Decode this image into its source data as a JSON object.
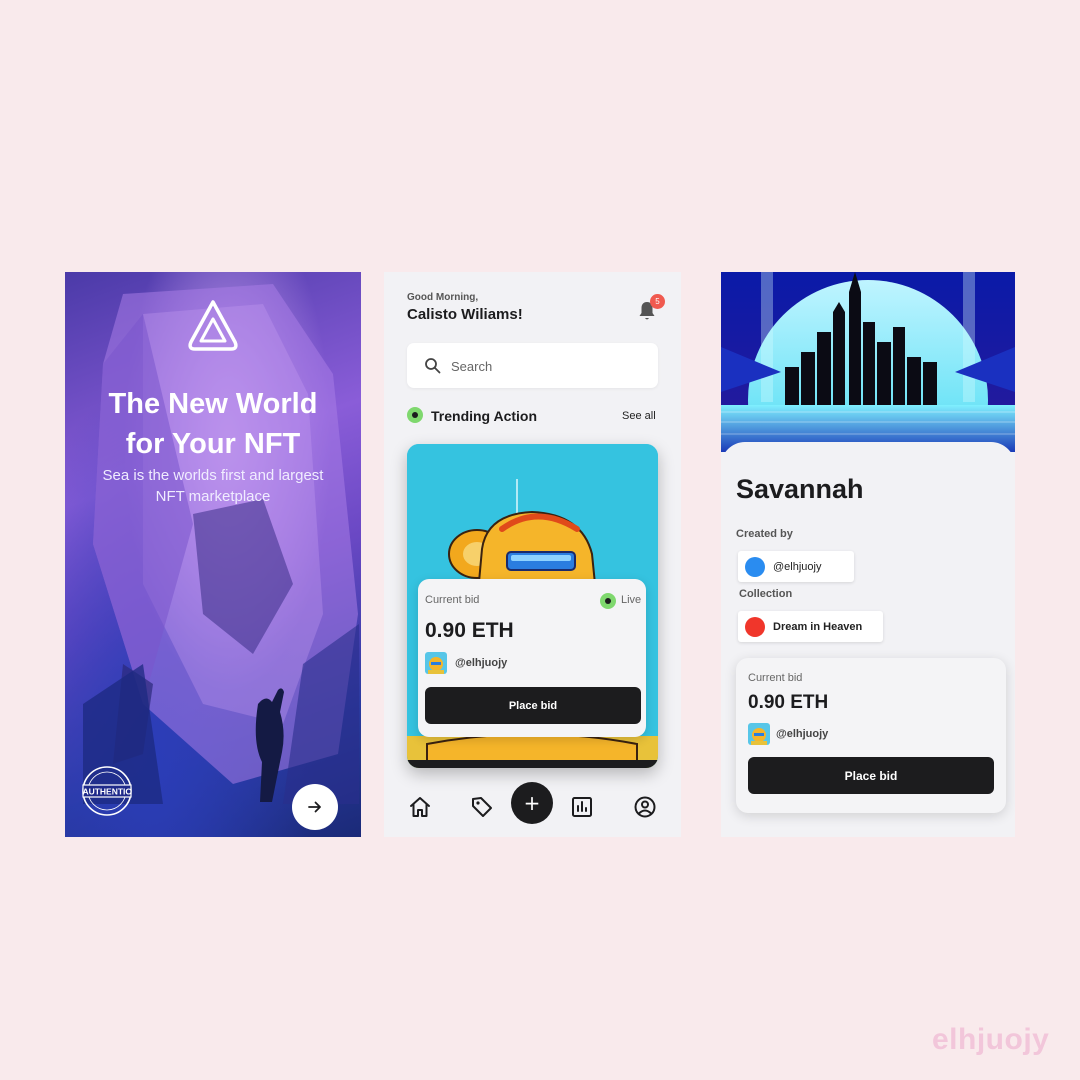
{
  "onboarding": {
    "title_line1": "The New World",
    "title_line2": "for Your NFT",
    "subtitle_line1": "Sea is the worlds first and largest",
    "subtitle_line2": "NFT marketplace",
    "badge_text": "AUTHENTIC",
    "next_icon": "arrow-right-icon"
  },
  "home": {
    "greeting": "Good Morning,",
    "user_name": "Calisto Wiliams!",
    "notification_count": "5",
    "search": {
      "placeholder": "Search"
    },
    "section_title": "Trending Action",
    "see_all": "See all",
    "card": {
      "bid_label": "Current bid",
      "status": "Live",
      "bid_value": "0.90 ETH",
      "handle": "@elhjuojy",
      "button": "Place bid"
    },
    "nav": [
      "home-icon",
      "tag-icon",
      "plus-icon",
      "chart-icon",
      "profile-icon"
    ],
    "fab_label": "+"
  },
  "detail": {
    "title": "Savannah",
    "created_by_label": "Created by",
    "creator_handle": "@elhjuojy",
    "collection_label": "Collection",
    "collection_name": "Dream in Heaven",
    "bid_label": "Current bid",
    "bid_value": "0.90 ETH",
    "handle": "@elhjuojy",
    "button": "Place bid"
  },
  "watermark": "elhjuojy",
  "colors": {
    "background": "#f9eaec",
    "dark": "#1c1c1e",
    "live_green": "#7fd86e",
    "notif_red": "#f05a4f",
    "creator_dot": "#2a8cf0",
    "collection_dot": "#f0362b"
  }
}
